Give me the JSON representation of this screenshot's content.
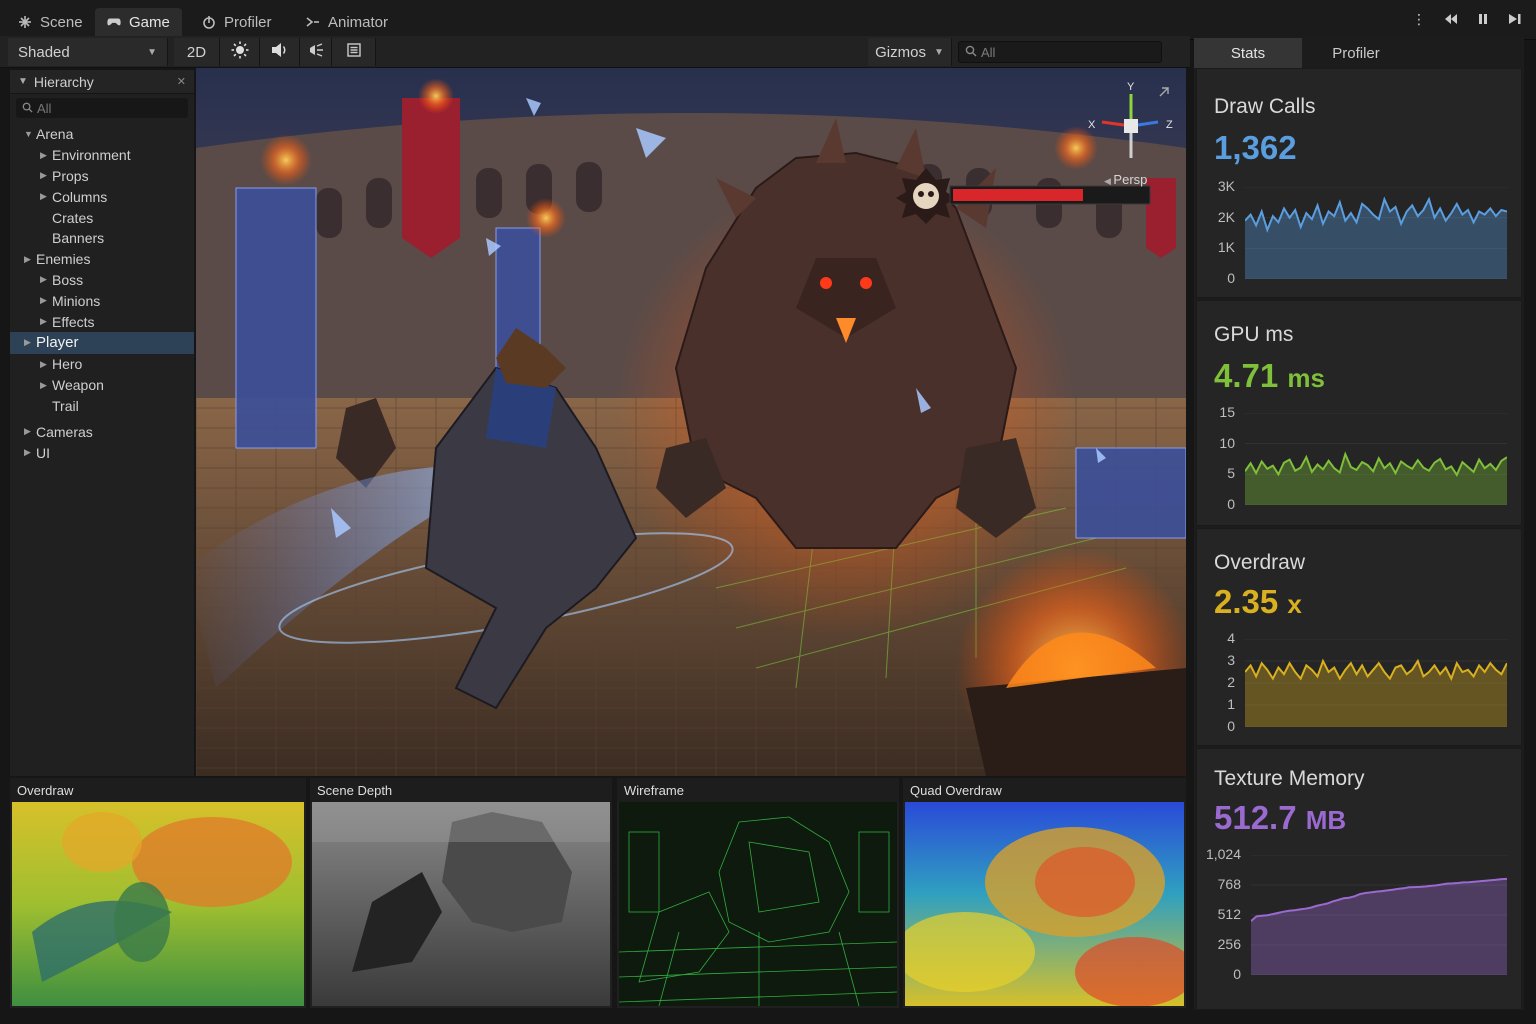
{
  "tabs": [
    {
      "label": "Scene",
      "icon": "scene-icon",
      "active": false
    },
    {
      "label": "Game",
      "icon": "gamepad-icon",
      "active": true
    },
    {
      "label": "Profiler",
      "icon": "profiler-icon",
      "active": false
    },
    {
      "label": "Animator",
      "icon": "animator-icon",
      "active": false
    }
  ],
  "toolbar": {
    "shading_mode": "Shaded",
    "mode_2d": "2D",
    "gizmos_label": "Gizmos",
    "search_placeholder": "All"
  },
  "hierarchy": {
    "title": "Hierarchy",
    "search_placeholder": "All",
    "items": [
      {
        "label": "Arena",
        "depth": 0,
        "expanded": true
      },
      {
        "label": "Environment",
        "depth": 1,
        "expandable": true
      },
      {
        "label": "Props",
        "depth": 1,
        "expandable": true
      },
      {
        "label": "Columns",
        "depth": 1,
        "expandable": true
      },
      {
        "label": "Crates",
        "depth": 1,
        "expandable": false
      },
      {
        "label": "Banners",
        "depth": 1,
        "expandable": false
      },
      {
        "label": "Enemies",
        "depth": 0,
        "expandable": true
      },
      {
        "label": "Boss",
        "depth": 1,
        "expandable": true
      },
      {
        "label": "Minions",
        "depth": 1,
        "expandable": true
      },
      {
        "label": "Effects",
        "depth": 1,
        "expandable": true
      },
      {
        "label": "Player",
        "depth": 0,
        "expandable": true,
        "selected": true
      },
      {
        "label": "Hero",
        "depth": 1,
        "expandable": true
      },
      {
        "label": "Weapon",
        "depth": 1,
        "expandable": true
      },
      {
        "label": "Trail",
        "depth": 1,
        "expandable": false
      },
      {
        "label": "Cameras",
        "depth": 0,
        "expandable": true
      },
      {
        "label": "UI",
        "depth": 0,
        "expandable": true
      }
    ]
  },
  "game": {
    "boss_health_fraction": 0.67,
    "gizmo_axes": [
      "Y",
      "X",
      "Z"
    ],
    "projection_label": "Persp"
  },
  "debug_views": [
    {
      "label": "Overdraw"
    },
    {
      "label": "Scene Depth"
    },
    {
      "label": "Wireframe"
    },
    {
      "label": "Quad Overdraw"
    }
  ],
  "stats_tabs": [
    {
      "label": "Stats",
      "active": true
    },
    {
      "label": "Profiler",
      "active": false
    }
  ],
  "stats": [
    {
      "title": "Draw Calls",
      "value": "1,362",
      "unit": "",
      "color": "#5a9ee0",
      "ticks": [
        "3K",
        "2K",
        "1K",
        "0"
      ],
      "ymax": 3000,
      "series": [
        1900,
        2100,
        1750,
        2200,
        1600,
        2050,
        1850,
        2300,
        2000,
        2250,
        1700,
        2150,
        1950,
        2400,
        1800,
        2200,
        2050,
        2500,
        1900,
        2150,
        1850,
        2450,
        2300,
        2100,
        1950,
        2600,
        2200,
        2350,
        1800,
        2200,
        2400,
        2050,
        2250,
        2600,
        2000,
        2300,
        1900,
        2150,
        2450,
        2100,
        2250,
        1850,
        2200,
        2100,
        2300,
        2050,
        2250,
        2200
      ]
    },
    {
      "title": "GPU ms",
      "value": "4.71",
      "unit": "ms",
      "color": "#7fbf3a",
      "ticks": [
        "15",
        "10",
        "5",
        "0"
      ],
      "ymax": 15,
      "series": [
        5.5,
        6.8,
        5.2,
        7.1,
        5.9,
        6.4,
        5.0,
        6.9,
        7.4,
        5.6,
        6.1,
        7.8,
        5.4,
        6.6,
        5.8,
        7.2,
        6.0,
        5.3,
        8.3,
        6.2,
        5.7,
        7.0,
        6.5,
        5.5,
        7.6,
        6.0,
        6.8,
        5.2,
        7.1,
        6.4,
        5.9,
        7.3,
        6.1,
        5.6,
        6.9,
        7.5,
        5.8,
        6.3,
        4.9,
        7.0,
        6.2,
        5.4,
        7.4,
        6.0,
        6.7,
        5.7,
        7.2,
        7.8
      ]
    },
    {
      "title": "Overdraw",
      "value": "2.35",
      "unit": "x",
      "color": "#d9b01f",
      "ticks": [
        "4",
        "3",
        "2",
        "1",
        "0"
      ],
      "ymax": 4,
      "series": [
        2.5,
        2.8,
        2.3,
        2.9,
        2.6,
        2.2,
        2.7,
        2.4,
        2.9,
        2.5,
        2.2,
        2.8,
        2.6,
        2.3,
        3.0,
        2.5,
        2.7,
        2.2,
        2.6,
        2.9,
        2.4,
        2.8,
        2.3,
        2.6,
        2.9,
        2.5,
        2.2,
        2.7,
        2.8,
        2.4,
        2.6,
        3.0,
        2.3,
        2.5,
        2.8,
        2.4,
        2.7,
        2.2,
        2.9,
        2.5,
        2.6,
        2.3,
        2.8,
        2.5,
        2.9,
        2.6,
        2.4,
        2.9
      ]
    },
    {
      "title": "Texture Memory",
      "value": "512.7",
      "unit": "MB",
      "color": "#9a6ad0",
      "ticks": [
        "1,024",
        "768",
        "512",
        "256",
        "0"
      ],
      "ymax": 1024,
      "series": [
        460,
        500,
        505,
        510,
        520,
        530,
        540,
        548,
        552,
        560,
        566,
        575,
        590,
        600,
        610,
        628,
        640,
        655,
        660,
        672,
        690,
        700,
        705,
        712,
        716,
        722,
        728,
        735,
        740,
        748,
        750,
        752,
        755,
        760,
        765,
        772,
        780,
        782,
        785,
        790,
        792,
        796,
        800,
        805,
        808,
        812,
        818,
        820
      ]
    }
  ]
}
